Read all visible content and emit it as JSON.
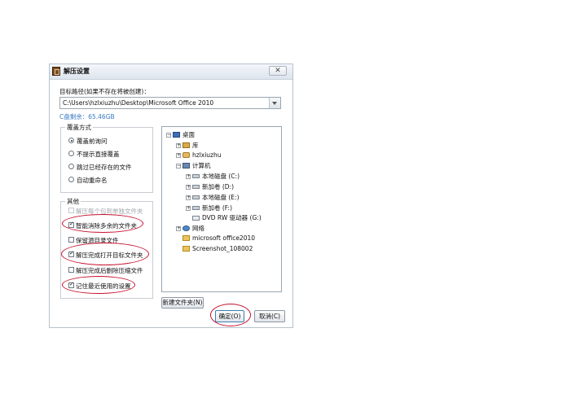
{
  "dialog": {
    "title": "解压设置",
    "close_symbol": "✕"
  },
  "target": {
    "label": "目标路径(如果不存在将被创建)：",
    "path": "C:\\Users\\hzlxiuzhu\\Desktop\\Microsoft Office 2010",
    "free_space": "C盘剩余：65.46GB"
  },
  "overwrite": {
    "title": "覆盖方式",
    "options": [
      {
        "label": "覆盖前询问",
        "selected": true
      },
      {
        "label": "不提示直接覆盖",
        "selected": false
      },
      {
        "label": "跳过已经存在的文件",
        "selected": false
      },
      {
        "label": "自动重命名",
        "selected": false
      }
    ]
  },
  "other": {
    "title": "其他",
    "options": [
      {
        "label": "解压每个包到单独文件夹",
        "checked": false,
        "disabled": true
      },
      {
        "label": "智能消除多余的文件夹",
        "checked": true,
        "disabled": false
      },
      {
        "label": "保留源目录文件",
        "checked": false,
        "disabled": false
      },
      {
        "label": "解压完成打开目标文件夹",
        "checked": true,
        "disabled": false
      },
      {
        "label": "解压完成后删除压缩文件",
        "checked": false,
        "disabled": false
      },
      {
        "label": "记住最近使用的设置",
        "checked": true,
        "disabled": false
      }
    ]
  },
  "tree": {
    "items": [
      {
        "label": "桌面",
        "icon": "desktop-icon",
        "expander": "−"
      },
      {
        "label": "库",
        "icon": "library-icon",
        "expander": "+"
      },
      {
        "label": "hzlxiuzhu",
        "icon": "user-folder-icon",
        "expander": "+"
      },
      {
        "label": "计算机",
        "icon": "computer-icon",
        "expander": "−"
      },
      {
        "label": "本地磁盘 (C:)",
        "icon": "drive-icon",
        "expander": "+"
      },
      {
        "label": "新加卷 (D:)",
        "icon": "drive-icon",
        "expander": "+"
      },
      {
        "label": "本地磁盘 (E:)",
        "icon": "drive-icon",
        "expander": "+"
      },
      {
        "label": "新加卷 (F:)",
        "icon": "drive-icon",
        "expander": "+"
      },
      {
        "label": "DVD RW 驱动器 (G:)",
        "icon": "dvd-drive-icon",
        "expander": ""
      },
      {
        "label": "网络",
        "icon": "network-icon",
        "expander": "+"
      },
      {
        "label": "microsoft office2010",
        "icon": "folder-icon",
        "expander": ""
      },
      {
        "label": "Screenshot_108002",
        "icon": "folder-icon",
        "expander": ""
      }
    ]
  },
  "buttons": {
    "new_folder": "新建文件夹(N)",
    "ok": "确定(O)",
    "cancel": "取消(C)"
  },
  "colors": {
    "accent": "#3a78c2",
    "annotation": "#c8102e"
  }
}
